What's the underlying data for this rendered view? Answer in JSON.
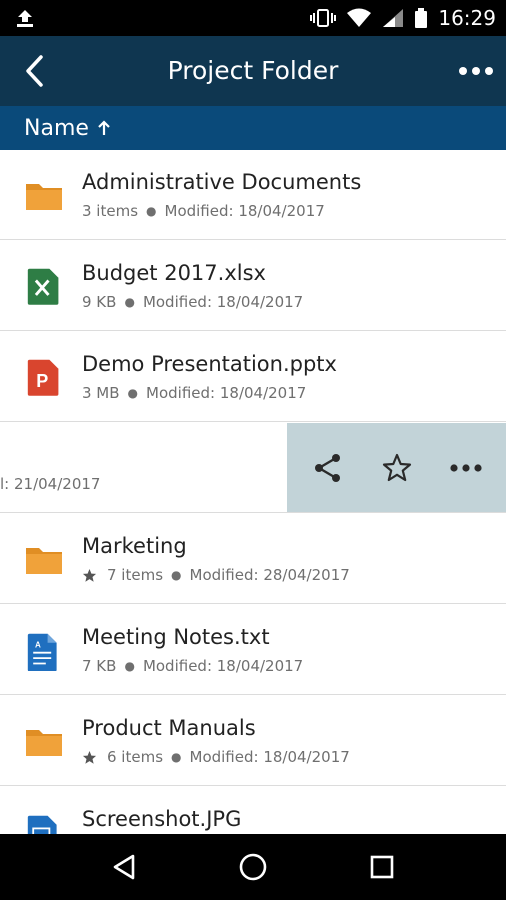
{
  "status_bar": {
    "time": "16:29",
    "icons": [
      "upload-icon",
      "vibrate-icon",
      "wifi-icon",
      "signal-icon",
      "battery-icon"
    ]
  },
  "app_bar": {
    "title": "Project Folder",
    "back_icon": "chevron-left-icon",
    "menu_icon": "more-horizontal-icon"
  },
  "sort_bar": {
    "label": "Name",
    "direction_icon": "arrow-up-icon"
  },
  "files": [
    {
      "name": "Administrative Documents",
      "type": "folder",
      "size": "3 items",
      "modified": "Modified: 18/04/2017",
      "starred": false
    },
    {
      "name": "Budget 2017.xlsx",
      "type": "excel",
      "size": "9 KB",
      "modified": "Modified: 18/04/2017",
      "starred": false
    },
    {
      "name": "Demo Presentation.pptx",
      "type": "powerpoint",
      "size": "3 MB",
      "modified": "Modified: 18/04/2017",
      "starred": false
    },
    {
      "name": "",
      "type": "swiped",
      "modified_partial": "l: 21/04/2017",
      "actions": [
        "share-icon",
        "star-outline-icon",
        "more-horizontal-icon"
      ]
    },
    {
      "name": "Marketing",
      "type": "folder",
      "size": "7 items",
      "modified": "Modified: 28/04/2017",
      "starred": true
    },
    {
      "name": "Meeting Notes.txt",
      "type": "text",
      "size": "7 KB",
      "modified": "Modified: 18/04/2017",
      "starred": false
    },
    {
      "name": "Product Manuals",
      "type": "folder",
      "size": "6 items",
      "modified": "Modified: 18/04/2017",
      "starred": true
    },
    {
      "name": "Screenshot.JPG",
      "type": "image",
      "size": "",
      "modified": "",
      "starred": false
    }
  ],
  "colors": {
    "app_bar": "#0f3650",
    "sort_bar": "#0a4a7a",
    "folder": "#f0a23a",
    "excel": "#2e7d45",
    "powerpoint": "#d9452e",
    "text_doc": "#1f6fbf",
    "swipe_actions_bg": "#c2d3d8"
  },
  "nav_bar": {
    "icons": [
      "back-triangle-icon",
      "home-circle-icon",
      "recents-square-icon"
    ]
  }
}
